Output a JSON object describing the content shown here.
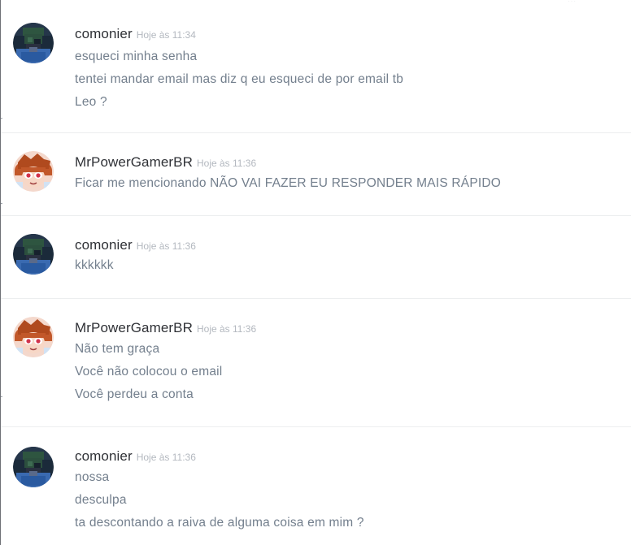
{
  "header": {
    "partial_text": "..."
  },
  "messages": [
    {
      "author": "comonier",
      "timestamp": "Hoje às 11:34",
      "avatar_icon": "comonier-avatar-icon",
      "lines": [
        "esqueci minha senha",
        "tentei mandar email mas diz q eu esqueci de por email tb",
        "Leo ?"
      ]
    },
    {
      "author": "MrPowerGamerBR",
      "timestamp": "Hoje às 11:36",
      "avatar_icon": "mrpowergamerbr-avatar-icon",
      "lines": [
        "Ficar me mencionando NÃO VAI FAZER EU RESPONDER MAIS RÁPIDO"
      ]
    },
    {
      "author": "comonier",
      "timestamp": "Hoje às 11:36",
      "avatar_icon": "comonier-avatar-icon",
      "lines": [
        "kkkkkk"
      ]
    },
    {
      "author": "MrPowerGamerBR",
      "timestamp": "Hoje às 11:36",
      "avatar_icon": "mrpowergamerbr-avatar-icon",
      "lines": [
        "Não tem graça",
        "Você não colocou o email",
        "Você perdeu a conta"
      ]
    },
    {
      "author": "comonier",
      "timestamp": "Hoje às 11:36",
      "avatar_icon": "comonier-avatar-icon",
      "lines": [
        "nossa",
        "desculpa",
        "ta descontando a raiva de alguma coisa em mim ?"
      ]
    }
  ],
  "colors": {
    "username": "#2f3136",
    "timestamp": "#b3b8bf",
    "message_text": "#737f8d",
    "divider": "#eceeef",
    "frame_border": "#6f7176"
  }
}
